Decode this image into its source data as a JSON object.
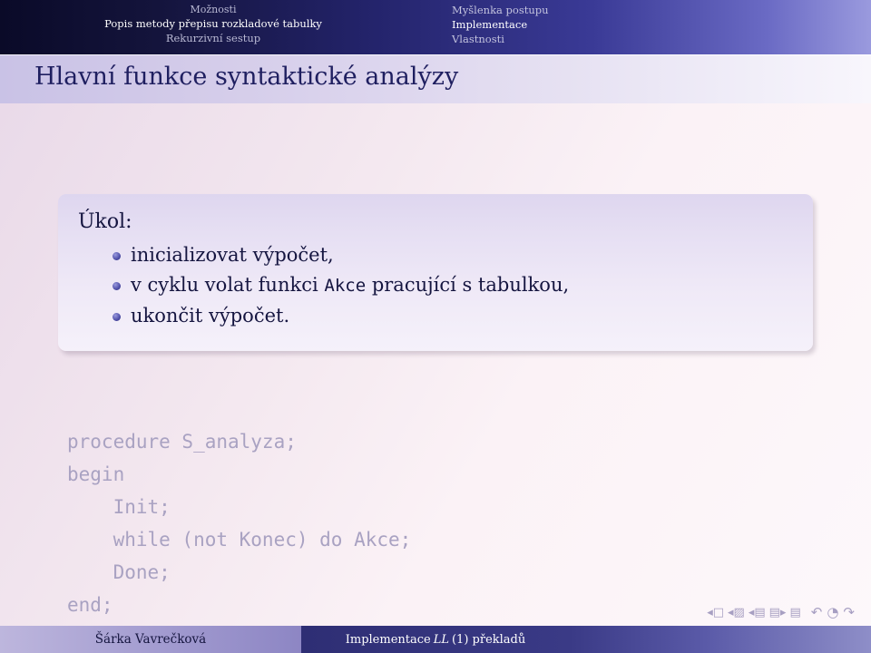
{
  "navbar": {
    "left_section_title": "Možnosti",
    "left_items": [
      {
        "label": "Popis metody přepisu rozkladové tabulky",
        "active": true
      },
      {
        "label": "Rekurzivní sestup",
        "active": false
      }
    ],
    "right_items": [
      {
        "label": "Myšlenka postupu",
        "active": false
      },
      {
        "label": "Implementace",
        "active": true
      },
      {
        "label": "Vlastnosti",
        "active": false
      }
    ]
  },
  "slide": {
    "title": "Hlavní funkce syntaktické analýzy",
    "block": {
      "heading": "Úkol:",
      "bullets": [
        {
          "pre": "inicializovat výpočet,",
          "code": "",
          "post": ""
        },
        {
          "pre": "v cyklu volat funkci ",
          "code": "Akce",
          "post": " pracující s tabulkou,"
        },
        {
          "pre": "ukončit výpočet.",
          "code": "",
          "post": ""
        }
      ]
    },
    "code_listing": "procedure S_analyza;\nbegin\n    Init;\n    while (not Konec) do Akce;\n    Done;\nend;"
  },
  "footer": {
    "author": "Šárka Vavrečková",
    "center_prefix": "Implementace ",
    "center_math": "LL",
    "center_suffix": "(1) překladů"
  },
  "nav_symbols": {
    "first": "◂□",
    "prev_section": "◂▨",
    "prev_frame": "◂▤",
    "next_frame": "▤▸",
    "next_section": "▤",
    "back": "↶",
    "search": "◔",
    "forward": "↷"
  }
}
